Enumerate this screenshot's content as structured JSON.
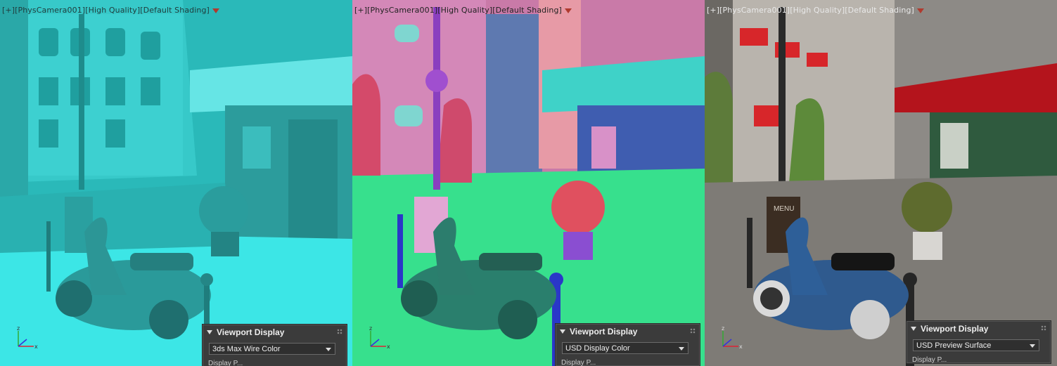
{
  "viewports": [
    {
      "label": {
        "menu": "[+]",
        "camera": "[PhysCamera001]",
        "quality": "[High Quality]",
        "shading": "[Default Shading]"
      },
      "panel": {
        "title": "Viewport Display",
        "dropdown_value": "3ds Max Wire Color",
        "cut_text": "Display P..."
      },
      "colors": {
        "primary": "#33d6d6",
        "shadow": "#1d8e8e",
        "ground": "#2fe3e3"
      }
    },
    {
      "label": {
        "menu": "[+]",
        "camera": "[PhysCamera001]",
        "quality": "[High Quality]",
        "shading": "[Default Shading]"
      },
      "panel": {
        "title": "Viewport Display",
        "dropdown_value": "USD Display Color",
        "cut_text": "Display P..."
      },
      "colors": {
        "primary": "#d97bb0",
        "shadow": "#4a5ba8",
        "ground": "#3ee897"
      }
    },
    {
      "label": {
        "menu": "[+]",
        "camera": "[PhysCamera001]",
        "quality": "[High Quality]",
        "shading": "[Default Shading]"
      },
      "panel": {
        "title": "Viewport Display",
        "dropdown_value": "USD Preview Surface",
        "cut_text": "Display P..."
      },
      "colors": {
        "primary": "#cfcac2",
        "shadow": "#4e4a44",
        "ground": "#8a8782"
      }
    }
  ],
  "scene_sign_text": "MENU",
  "icons": {
    "filter": "filter-funnel-icon",
    "axis": "xyz-axis-gizmo-icon",
    "dropdown": "chevron-down-icon",
    "grip": "panel-grip-icon",
    "collapse": "collapse-triangle-icon"
  }
}
